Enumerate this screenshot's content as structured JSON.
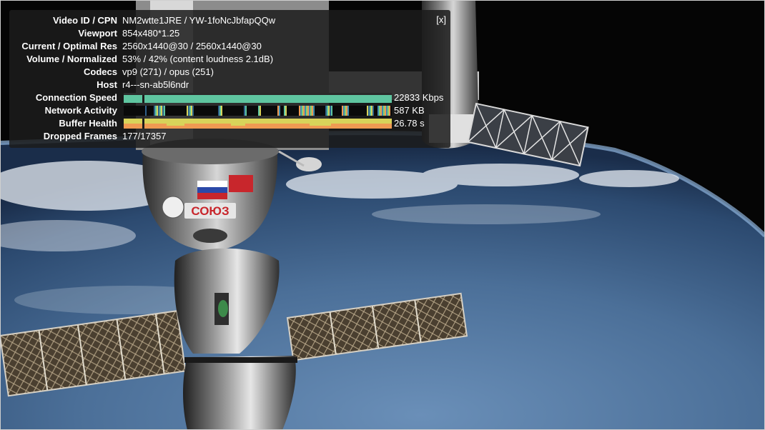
{
  "stats": {
    "close_label": "[x]",
    "rows": [
      {
        "label": "Video ID / CPN",
        "value": "NM2wtte1JRE / YW-1foNcJbfapQQw"
      },
      {
        "label": "Viewport",
        "value": "854x480*1.25"
      },
      {
        "label": "Current / Optimal Res",
        "value": "2560x1440@30 / 2560x1440@30"
      },
      {
        "label": "Volume / Normalized",
        "value": "53% / 42% (content loudness 2.1dB)"
      },
      {
        "label": "Codecs",
        "value": "vp9 (271) / opus (251)"
      },
      {
        "label": "Host",
        "value": "r4---sn-ab5l6ndr"
      }
    ],
    "connection_speed": {
      "label": "Connection Speed",
      "value": "22833 Kbps"
    },
    "network_activity": {
      "label": "Network Activity",
      "value": "587 KB"
    },
    "buffer_health": {
      "label": "Buffer Health",
      "value": "26.78 s"
    },
    "dropped_frames": {
      "label": "Dropped Frames",
      "value": "177/17357"
    }
  },
  "scene": {
    "capsule_label": "СОЮЗ"
  },
  "colors": {
    "overlay_bg": "#1c1c1c",
    "speed_bar": "#5fc5a0",
    "buffer_bar_top": "#d8d35a",
    "buffer_bar_bottom": "#ef9a52",
    "capsule_text": "#c8262c"
  }
}
